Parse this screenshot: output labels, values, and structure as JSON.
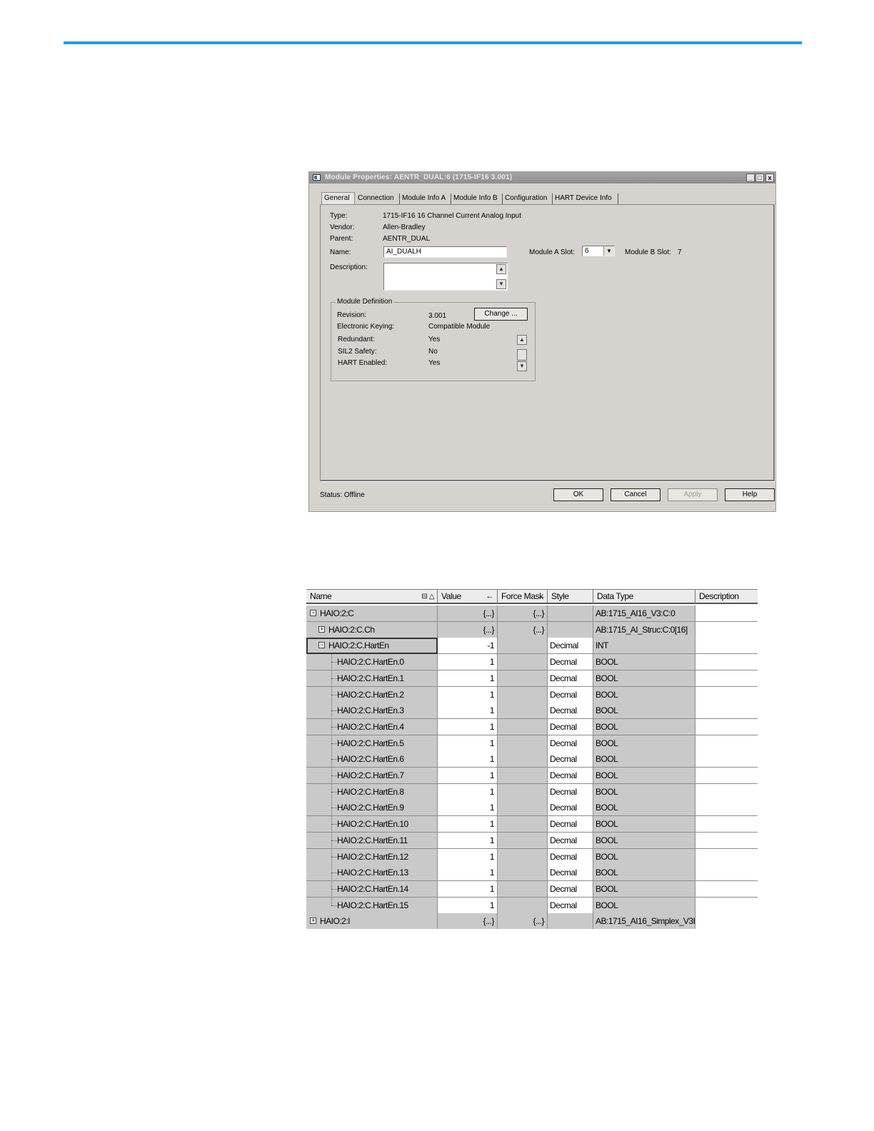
{
  "dialog": {
    "title": "Module Properties: AENTR_DUAL:6 (1715-IF16 3.001)",
    "window_buttons": [
      "_",
      "□",
      "x"
    ],
    "tabs": [
      "General",
      "Connection",
      "Module Info A",
      "Module Info B",
      "Configuration",
      "HART Device Info"
    ],
    "active_tab": "General",
    "fields": {
      "type_label": "Type:",
      "type_value": "1715-IF16 16 Channel Current Analog Input",
      "vendor_label": "Vendor:",
      "vendor_value": "Allen-Bradley",
      "parent_label": "Parent:",
      "parent_value": "AENTR_DUAL",
      "name_label": "Name:",
      "name_value": "AI_DUALH",
      "description_label": "Description:",
      "description_value": "",
      "module_a_slot_label": "Module A Slot:",
      "module_a_slot_value": "6",
      "module_b_slot_label": "Module B Slot:",
      "module_b_slot_value": "7"
    },
    "module_definition": {
      "title": "Module Definition",
      "revision_label": "Revision:",
      "revision_value": "3.001",
      "change_button": "Change ...",
      "keying_label": "Electronic Keying:",
      "keying_value": "Compatible Module",
      "redundant_label": "Redundant:",
      "redundant_value": "Yes",
      "sil2_label": "SIL2 Safety:",
      "sil2_value": "No",
      "hart_label": "HART Enabled:",
      "hart_value": "Yes"
    },
    "status": "Status:  Offline",
    "buttons": {
      "ok": "OK",
      "cancel": "Cancel",
      "apply": "Apply",
      "help": "Help"
    }
  },
  "tag_table": {
    "columns": [
      "Name",
      "Value",
      "Force Mask",
      "Style",
      "Data Type",
      "Description"
    ],
    "rows": [
      {
        "name": "HAIO:2:C",
        "value": "{...}",
        "force": "{...}",
        "style": "",
        "type": "AB:1715_AI16_V3:C:0",
        "desc": ""
      },
      {
        "name": "HAIO:2:C.Ch",
        "value": "{...}",
        "force": "{...}",
        "style": "",
        "type": "AB:1715_AI_Struc:C:0[16]",
        "desc": ""
      },
      {
        "name": "HAIO:2:C.HartEn",
        "value": "-1",
        "force": "",
        "style": "Decimal",
        "type": "INT",
        "desc": ""
      },
      {
        "name": "HAIO:2:C.HartEn.0",
        "value": "1",
        "force": "",
        "style": "Decmal",
        "type": "BOOL",
        "desc": ""
      },
      {
        "name": "HAIO:2:C.HartEn.1",
        "value": "1",
        "force": "",
        "style": "Decmal",
        "type": "BOOL",
        "desc": ""
      },
      {
        "name": "HAIO:2:C.HartEn.2",
        "value": "1",
        "force": "",
        "style": "Decmal",
        "type": "BOOL",
        "desc": ""
      },
      {
        "name": "HAIO:2:C.HartEn.3",
        "value": "1",
        "force": "",
        "style": "Decmal",
        "type": "BOOL",
        "desc": ""
      },
      {
        "name": "HAIO:2:C.HartEn.4",
        "value": "1",
        "force": "",
        "style": "Decmal",
        "type": "BOOL",
        "desc": ""
      },
      {
        "name": "HAIO:2:C.HartEn.5",
        "value": "1",
        "force": "",
        "style": "Decmal",
        "type": "BOOL",
        "desc": ""
      },
      {
        "name": "HAIO:2:C.HartEn.6",
        "value": "1",
        "force": "",
        "style": "Decmal",
        "type": "BOOL",
        "desc": ""
      },
      {
        "name": "HAIO:2:C.HartEn.7",
        "value": "1",
        "force": "",
        "style": "Decmal",
        "type": "BOOL",
        "desc": ""
      },
      {
        "name": "HAIO:2:C.HartEn.8",
        "value": "1",
        "force": "",
        "style": "Decmal",
        "type": "BOOL",
        "desc": ""
      },
      {
        "name": "HAIO:2:C.HartEn.9",
        "value": "1",
        "force": "",
        "style": "Decmal",
        "type": "BOOL",
        "desc": ""
      },
      {
        "name": "HAIO:2:C.HartEn.10",
        "value": "1",
        "force": "",
        "style": "Decmal",
        "type": "BOOL",
        "desc": ""
      },
      {
        "name": "HAIO:2:C.HartEn.11",
        "value": "1",
        "force": "",
        "style": "Decmal",
        "type": "BOOL",
        "desc": ""
      },
      {
        "name": "HAIO:2:C.HartEn.12",
        "value": "1",
        "force": "",
        "style": "Decmal",
        "type": "BOOL",
        "desc": ""
      },
      {
        "name": "HAIO:2:C.HartEn.13",
        "value": "1",
        "force": "",
        "style": "Decmal",
        "type": "BOOL",
        "desc": ""
      },
      {
        "name": "HAIO:2:C.HartEn.14",
        "value": "1",
        "force": "",
        "style": "Decmal",
        "type": "BOOL",
        "desc": ""
      },
      {
        "name": "HAIO:2:C.HartEn.15",
        "value": "1",
        "force": "",
        "style": "Decmal",
        "type": "BOOL",
        "desc": ""
      },
      {
        "name": "HAIO:2:I",
        "value": "{...}",
        "force": "{...}",
        "style": "",
        "type": "AB:1715_AI16_Simplex_V3H...",
        "desc": ""
      }
    ]
  },
  "colors": {
    "accent_line": "#1ba0e2",
    "dialog_bg": "#d6d3ce",
    "row_grey": "#c9c9c9"
  }
}
